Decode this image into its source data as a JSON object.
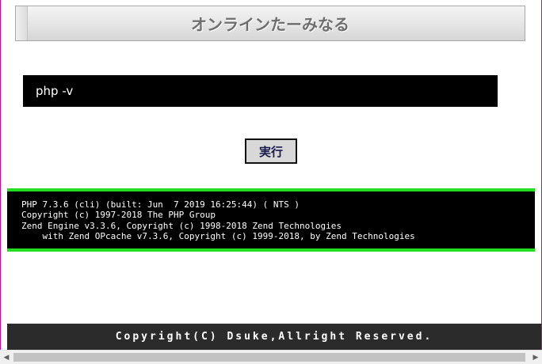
{
  "header": {
    "title": "オンラインたーみなる"
  },
  "command": {
    "value": "php -v"
  },
  "run_button": {
    "label": "実行"
  },
  "output": {
    "lines": [
      "PHP 7.3.6 (cli) (built: Jun  7 2019 16:25:44) ( NTS )",
      "Copyright (c) 1997-2018 The PHP Group",
      "Zend Engine v3.3.6, Copyright (c) 1998-2018 Zend Technologies",
      "    with Zend OPcache v7.3.6, Copyright (c) 1999-2018, by Zend Technologies"
    ]
  },
  "footer": {
    "text": "Copyright(C) Dsuke,Allright Reserved."
  },
  "scrollbar": {
    "left_icon": "triangle-left-icon",
    "right_icon": "triangle-right-icon",
    "left_glyph": "◀",
    "right_glyph": "▶"
  },
  "colors": {
    "output_border": "#22dd22",
    "footer_bg": "#2b2b2b",
    "terminal_bg": "#000000"
  }
}
